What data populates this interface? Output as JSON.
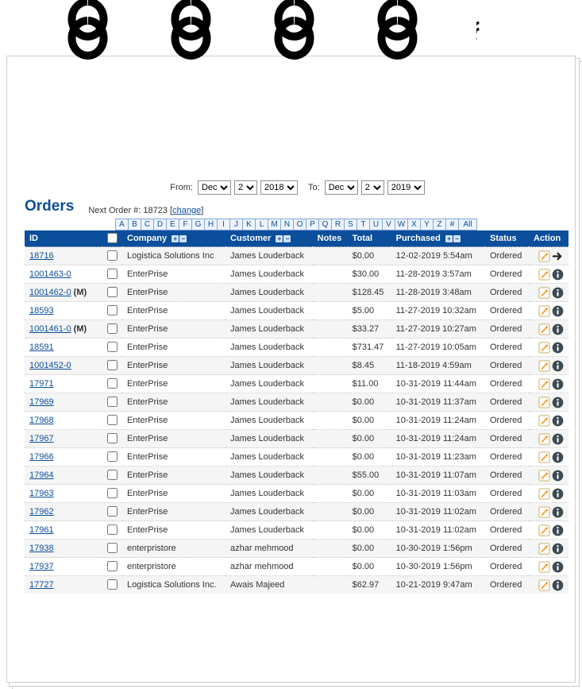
{
  "page": {
    "title": "Orders",
    "next_order_label": "Next Order #:",
    "next_order_value": "18723",
    "change_label": "change"
  },
  "date_filter": {
    "from_label": "From:",
    "to_label": "To:",
    "from_month": "Dec",
    "from_day": "2",
    "from_year": "2018",
    "to_month": "Dec",
    "to_day": "2",
    "to_year": "2019"
  },
  "alpha": [
    "A",
    "B",
    "C",
    "D",
    "E",
    "F",
    "G",
    "H",
    "I",
    "J",
    "K",
    "L",
    "M",
    "N",
    "O",
    "P",
    "Q",
    "R",
    "S",
    "T",
    "U",
    "V",
    "W",
    "X",
    "Y",
    "Z",
    "#",
    "All"
  ],
  "columns": {
    "id": "ID",
    "company": "Company",
    "customer": "Customer",
    "notes": "Notes",
    "total": "Total",
    "purchased": "Purchased",
    "status": "Status",
    "action": "Action"
  },
  "rows": [
    {
      "id": "18716",
      "suffix": "",
      "company": "Logistica Solutions Inc",
      "customer": "James Louderback",
      "total": "$0.00",
      "purchased": "12-02-2019 5:54am",
      "status": "Ordered",
      "go": true
    },
    {
      "id": "1001463-0",
      "suffix": "",
      "company": "EnterPrise",
      "customer": "James Louderback",
      "total": "$30.00",
      "purchased": "11-28-2019 3:57am",
      "status": "Ordered",
      "go": false
    },
    {
      "id": "1001462-0",
      "suffix": " (M)",
      "company": "EnterPrise",
      "customer": "James Louderback",
      "total": "$128.45",
      "purchased": "11-28-2019 3:48am",
      "status": "Ordered",
      "go": false
    },
    {
      "id": "18593",
      "suffix": "",
      "company": "EnterPrise",
      "customer": "James Louderback",
      "total": "$5.00",
      "purchased": "11-27-2019 10:32am",
      "status": "Ordered",
      "go": false
    },
    {
      "id": "1001461-0",
      "suffix": " (M)",
      "company": "EnterPrise",
      "customer": "James Louderback",
      "total": "$33.27",
      "purchased": "11-27-2019 10:27am",
      "status": "Ordered",
      "go": false
    },
    {
      "id": "18591",
      "suffix": "",
      "company": "EnterPrise",
      "customer": "James Louderback",
      "total": "$731.47",
      "purchased": "11-27-2019 10:05am",
      "status": "Ordered",
      "go": false
    },
    {
      "id": "1001452-0",
      "suffix": "",
      "company": "EnterPrise",
      "customer": "James Louderback",
      "total": "$8.45",
      "purchased": "11-18-2019 4:59am",
      "status": "Ordered",
      "go": false
    },
    {
      "id": "17971",
      "suffix": "",
      "company": "EnterPrise",
      "customer": "James Louderback",
      "total": "$11.00",
      "purchased": "10-31-2019 11:44am",
      "status": "Ordered",
      "go": false
    },
    {
      "id": "17969",
      "suffix": "",
      "company": "EnterPrise",
      "customer": "James Louderback",
      "total": "$0.00",
      "purchased": "10-31-2019 11:37am",
      "status": "Ordered",
      "go": false
    },
    {
      "id": "17968",
      "suffix": "",
      "company": "EnterPrise",
      "customer": "James Louderback",
      "total": "$0.00",
      "purchased": "10-31-2019 11:24am",
      "status": "Ordered",
      "go": false
    },
    {
      "id": "17967",
      "suffix": "",
      "company": "EnterPrise",
      "customer": "James Louderback",
      "total": "$0.00",
      "purchased": "10-31-2019 11:24am",
      "status": "Ordered",
      "go": false
    },
    {
      "id": "17966",
      "suffix": "",
      "company": "EnterPrise",
      "customer": "James Louderback",
      "total": "$0.00",
      "purchased": "10-31-2019 11:23am",
      "status": "Ordered",
      "go": false
    },
    {
      "id": "17964",
      "suffix": "",
      "company": "EnterPrise",
      "customer": "James Louderback",
      "total": "$55.00",
      "purchased": "10-31-2019 11:07am",
      "status": "Ordered",
      "go": false
    },
    {
      "id": "17963",
      "suffix": "",
      "company": "EnterPrise",
      "customer": "James Louderback",
      "total": "$0.00",
      "purchased": "10-31-2019 11:03am",
      "status": "Ordered",
      "go": false
    },
    {
      "id": "17962",
      "suffix": "",
      "company": "EnterPrise",
      "customer": "James Louderback",
      "total": "$0.00",
      "purchased": "10-31-2019 11:02am",
      "status": "Ordered",
      "go": false
    },
    {
      "id": "17961",
      "suffix": "",
      "company": "EnterPrise",
      "customer": "James Louderback",
      "total": "$0.00",
      "purchased": "10-31-2019 11:02am",
      "status": "Ordered",
      "go": false
    },
    {
      "id": "17938",
      "suffix": "",
      "company": "enterpristore",
      "customer": "azhar mehmood",
      "total": "$0.00",
      "purchased": "10-30-2019 1:56pm",
      "status": "Ordered",
      "go": false
    },
    {
      "id": "17937",
      "suffix": "",
      "company": "enterpristore",
      "customer": "azhar mehmood",
      "total": "$0.00",
      "purchased": "10-30-2019 1:56pm",
      "status": "Ordered",
      "go": false
    },
    {
      "id": "17727",
      "suffix": "",
      "company": "Logistica Solutions Inc.",
      "customer": "Awais Majeed",
      "total": "$62.97",
      "purchased": "10-21-2019 9:47am",
      "status": "Ordered",
      "go": false
    }
  ]
}
